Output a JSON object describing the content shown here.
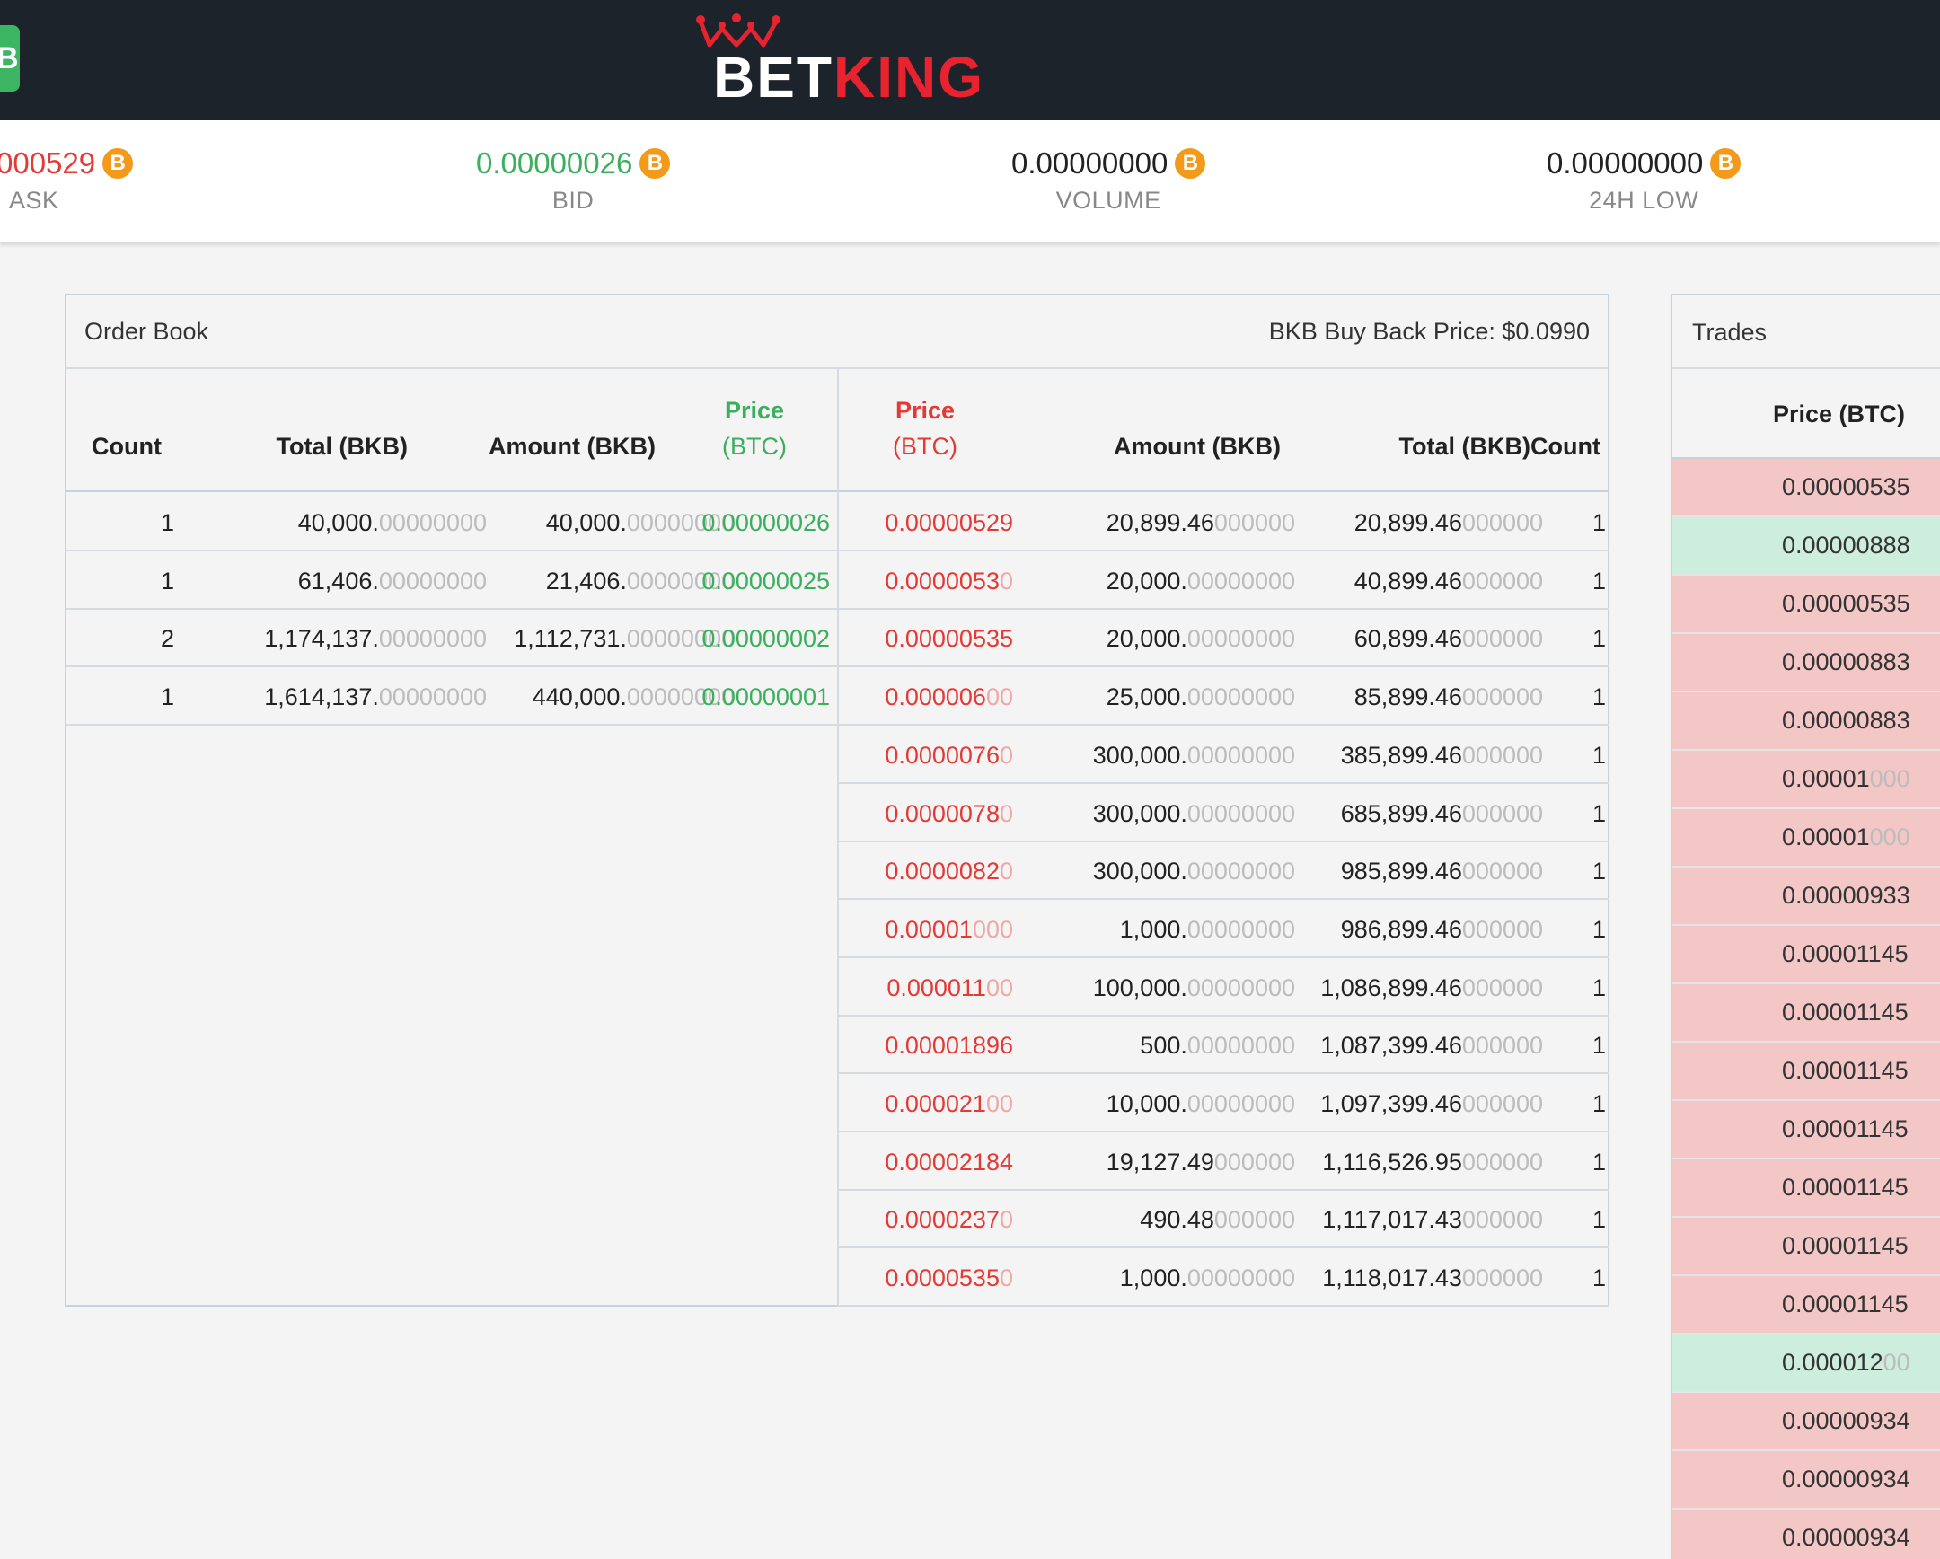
{
  "header": {
    "tab_label": "B",
    "logo_bet": "BET",
    "logo_king": "KING"
  },
  "ticker": [
    {
      "value": "000529",
      "label": "ASK",
      "color": "#e53935"
    },
    {
      "value": "0.00000026",
      "label": "BID",
      "color": "#3aaf5c"
    },
    {
      "value": "0.00000000",
      "label": "VOLUME",
      "color": "#222222"
    },
    {
      "value": "0.00000000",
      "label": "24H LOW",
      "color": "#222222"
    }
  ],
  "coin_icon": "bitcoin-icon",
  "coin_symbol": "B",
  "order_book": {
    "title": "Order Book",
    "buy_back": "BKB Buy Back Price: $0.0990",
    "buy_headers": {
      "count": "Count",
      "total": "Total (BKB)",
      "amount": "Amount (BKB)",
      "price_1": "Price",
      "price_2": "(BTC)"
    },
    "sell_headers": {
      "price_1": "Price",
      "price_2": "(BTC)",
      "amount": "Amount (BKB)",
      "total": "Total (BKB)",
      "count": "Count"
    },
    "bids": [
      {
        "count": "1",
        "total_main": "40,000.",
        "total_dim": "00000000",
        "amount_main": "40,000.",
        "amount_dim": "00000000",
        "price": "0.00000026"
      },
      {
        "count": "1",
        "total_main": "61,406.",
        "total_dim": "00000000",
        "amount_main": "21,406.",
        "amount_dim": "00000000",
        "price": "0.00000025"
      },
      {
        "count": "2",
        "total_main": "1,174,137.",
        "total_dim": "00000000",
        "amount_main": "1,112,731.",
        "amount_dim": "00000000",
        "price": "0.00000002"
      },
      {
        "count": "1",
        "total_main": "1,614,137.",
        "total_dim": "00000000",
        "amount_main": "440,000.",
        "amount_dim": "00000000",
        "price": "0.00000001"
      }
    ],
    "asks": [
      {
        "price_main": "0.00000529",
        "price_dim": "",
        "amount_main": "20,899.46",
        "amount_dim": "000000",
        "total_main": "20,899.46",
        "total_dim": "000000",
        "count": "1"
      },
      {
        "price_main": "0.0000053",
        "price_dim": "0",
        "amount_main": "20,000.",
        "amount_dim": "00000000",
        "total_main": "40,899.46",
        "total_dim": "000000",
        "count": "1"
      },
      {
        "price_main": "0.00000535",
        "price_dim": "",
        "amount_main": "20,000.",
        "amount_dim": "00000000",
        "total_main": "60,899.46",
        "total_dim": "000000",
        "count": "1"
      },
      {
        "price_main": "0.000006",
        "price_dim": "00",
        "amount_main": "25,000.",
        "amount_dim": "00000000",
        "total_main": "85,899.46",
        "total_dim": "000000",
        "count": "1"
      },
      {
        "price_main": "0.0000076",
        "price_dim": "0",
        "amount_main": "300,000.",
        "amount_dim": "00000000",
        "total_main": "385,899.46",
        "total_dim": "000000",
        "count": "1"
      },
      {
        "price_main": "0.0000078",
        "price_dim": "0",
        "amount_main": "300,000.",
        "amount_dim": "00000000",
        "total_main": "685,899.46",
        "total_dim": "000000",
        "count": "1"
      },
      {
        "price_main": "0.0000082",
        "price_dim": "0",
        "amount_main": "300,000.",
        "amount_dim": "00000000",
        "total_main": "985,899.46",
        "total_dim": "000000",
        "count": "1"
      },
      {
        "price_main": "0.00001",
        "price_dim": "000",
        "amount_main": "1,000.",
        "amount_dim": "00000000",
        "total_main": "986,899.46",
        "total_dim": "000000",
        "count": "1"
      },
      {
        "price_main": "0.000011",
        "price_dim": "00",
        "amount_main": "100,000.",
        "amount_dim": "00000000",
        "total_main": "1,086,899.46",
        "total_dim": "000000",
        "count": "1"
      },
      {
        "price_main": "0.00001896",
        "price_dim": "",
        "amount_main": "500.",
        "amount_dim": "00000000",
        "total_main": "1,087,399.46",
        "total_dim": "000000",
        "count": "1"
      },
      {
        "price_main": "0.000021",
        "price_dim": "00",
        "amount_main": "10,000.",
        "amount_dim": "00000000",
        "total_main": "1,097,399.46",
        "total_dim": "000000",
        "count": "1"
      },
      {
        "price_main": "0.00002184",
        "price_dim": "",
        "amount_main": "19,127.49",
        "amount_dim": "000000",
        "total_main": "1,116,526.95",
        "total_dim": "000000",
        "count": "1"
      },
      {
        "price_main": "0.0000237",
        "price_dim": "0",
        "amount_main": "490.48",
        "amount_dim": "000000",
        "total_main": "1,117,017.43",
        "total_dim": "000000",
        "count": "1"
      },
      {
        "price_main": "0.0000535",
        "price_dim": "0",
        "amount_main": "1,000.",
        "amount_dim": "00000000",
        "total_main": "1,118,017.43",
        "total_dim": "000000",
        "count": "1"
      }
    ]
  },
  "trades": {
    "title": "Trades",
    "column": "Price (BTC)",
    "rows": [
      {
        "main": "0.00000535",
        "dim": "",
        "side": "sell"
      },
      {
        "main": "0.00000888",
        "dim": "",
        "side": "buy"
      },
      {
        "main": "0.00000535",
        "dim": "",
        "side": "sell"
      },
      {
        "main": "0.00000883",
        "dim": "",
        "side": "sell"
      },
      {
        "main": "0.00000883",
        "dim": "",
        "side": "sell"
      },
      {
        "main": "0.00001",
        "dim": "000",
        "side": "sell"
      },
      {
        "main": "0.00001",
        "dim": "000",
        "side": "sell"
      },
      {
        "main": "0.00000933",
        "dim": "",
        "side": "sell"
      },
      {
        "main": "0.00001145",
        "dim": "",
        "side": "sell"
      },
      {
        "main": "0.00001145",
        "dim": "",
        "side": "sell"
      },
      {
        "main": "0.00001145",
        "dim": "",
        "side": "sell"
      },
      {
        "main": "0.00001145",
        "dim": "",
        "side": "sell"
      },
      {
        "main": "0.00001145",
        "dim": "",
        "side": "sell"
      },
      {
        "main": "0.00001145",
        "dim": "",
        "side": "sell"
      },
      {
        "main": "0.00001145",
        "dim": "",
        "side": "sell"
      },
      {
        "main": "0.000012",
        "dim": "00",
        "side": "buy"
      },
      {
        "main": "0.00000934",
        "dim": "",
        "side": "sell"
      },
      {
        "main": "0.00000934",
        "dim": "",
        "side": "sell"
      },
      {
        "main": "0.00000934",
        "dim": "",
        "side": "sell"
      }
    ]
  }
}
